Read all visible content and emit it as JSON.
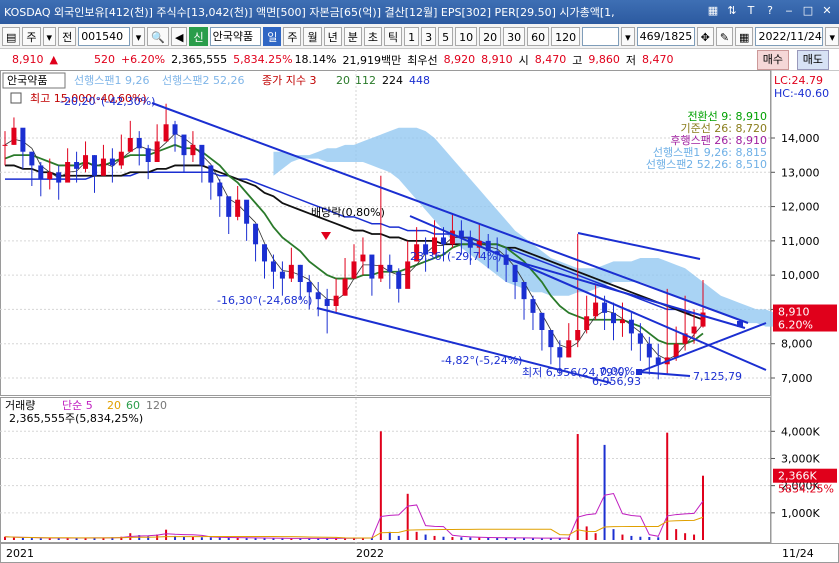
{
  "window": {
    "title": "KOSDAQ 외국인보유[412(천)] 주식수[13,042(천)] 액면[500] 자본금[65(억)] 결산[12월] EPS[302] PER[29.50] 시가총액[1,"
  },
  "toolbar": {
    "menu_label": "주",
    "prev_label": "전",
    "code": "001540",
    "new_badge": "신",
    "stock_name": "안국약품",
    "periods": [
      "일",
      "주",
      "월",
      "년",
      "분",
      "초",
      "틱"
    ],
    "selected_period": "일",
    "minutes": [
      "1",
      "3",
      "5",
      "10",
      "20",
      "30",
      "60",
      "120"
    ],
    "count": "469/1825",
    "date": "2022/11/24"
  },
  "price_bar": {
    "price": "8,910",
    "change": "520",
    "change_pct": "+6.20%",
    "volume": "2,365,555",
    "volume_pct": "5,834.25%",
    "turnover": "18.14%",
    "amount": "21,919백만",
    "best_ask_label": "최우선",
    "best_ask": "8,920",
    "best_bid": "8,910",
    "open_label": "시",
    "open": "8,470",
    "high_label": "고",
    "high": "9,860",
    "low_label": "저",
    "low": "8,470",
    "buy_label": "매수",
    "sell_label": "매도"
  },
  "chart_data": {
    "type": "line",
    "price_panel": {
      "legend": {
        "stock": "안국약품",
        "span1": "선행스팬1 9,26",
        "span2": "선행스팬2 52,26",
        "close_prefix": "종가 지수 3",
        "ma20": "20",
        "ma112": "112",
        "ma224": "224",
        "ma448": "448"
      },
      "right_info": {
        "lc": "LC:24.79",
        "hc": "HC:-40.60"
      },
      "ichimoku_legend": [
        {
          "text": "전환선 9: 8,910",
          "color": "#00a000"
        },
        {
          "text": "기준선 26: 8,720",
          "color": "#8a7d1c"
        },
        {
          "text": "후행스팬 26: 8,910",
          "color": "#a020a0"
        },
        {
          "text": "선행스팬1 9,26: 8,815",
          "color": "#6fb0e6"
        },
        {
          "text": "선행스팬2 52,26: 8,510",
          "color": "#6fb0e6"
        }
      ],
      "y_ticks": [
        7000,
        8000,
        9000,
        10000,
        11000,
        12000,
        13000,
        14000
      ],
      "y_tick_labels": [
        "7,000",
        "8,000",
        "9,000",
        "10,000",
        "11,000",
        "12,000",
        "13,000",
        "14,000"
      ],
      "ylim": [
        6650,
        15400
      ],
      "current_price": 8910,
      "current_price_label": "8,910",
      "current_pct_label": "6.20%",
      "annotations": {
        "high": "최고 15,000(-40,60%)",
        "high_trend": "-20,20°(-42,30%)",
        "dividend": "배당락(0.80%)",
        "trend1": "-16,30°(-24,68%)",
        "trend2": "23,36°(-29,74%)",
        "trend3": "-4,82°(-5,24%)",
        "low": "최저 6,956(24,79%)",
        "low_val": "6,956,93",
        "low_val2": "7,125,79",
        "mid_val": "0,00%"
      }
    },
    "volume_panel": {
      "legend": {
        "title": "거래량",
        "ma5": "단순 5",
        "ma20": "20",
        "ma60": "60",
        "ma120": "120"
      },
      "summary": "2,365,555주(5,834,25%)",
      "y_ticks": [
        1000000,
        2000000,
        3000000,
        4000000
      ],
      "y_tick_labels": [
        "1,000K",
        "2,000K",
        "3,000K",
        "4,000K"
      ],
      "ylim": [
        0,
        4600000
      ],
      "current_label": "2,366K",
      "current_pct_label": "5834.25%"
    },
    "x_labels": [
      "2021",
      "2022",
      "11/24"
    ],
    "close": [
      13800,
      14300,
      13600,
      13200,
      12800,
      13000,
      12700,
      13300,
      13100,
      13500,
      12900,
      13400,
      13200,
      13600,
      14000,
      13700,
      13300,
      13900,
      14400,
      14100,
      13500,
      13800,
      13200,
      12700,
      12300,
      11700,
      12200,
      11500,
      10900,
      10400,
      10100,
      9900,
      10300,
      9800,
      9500,
      9300,
      9100,
      9400,
      9900,
      10400,
      10600,
      9900,
      10300,
      10100,
      9600,
      10400,
      10900,
      10600,
      11100,
      10900,
      11300,
      11100,
      10800,
      11000,
      10700,
      10600,
      10300,
      9800,
      9300,
      8900,
      8400,
      7900,
      7600,
      8100,
      8400,
      8800,
      9200,
      8900,
      8600,
      8700,
      8300,
      8000,
      7600,
      7400,
      7600,
      8000,
      8300,
      8500,
      8910
    ],
    "high": [
      14200,
      14600,
      14100,
      13600,
      13300,
      13400,
      13200,
      13700,
      13600,
      13900,
      13500,
      13800,
      13700,
      14100,
      14500,
      14200,
      13800,
      14400,
      15000,
      14500,
      14000,
      14200,
      13700,
      13200,
      12800,
      12200,
      12600,
      12000,
      11400,
      10900,
      10600,
      10400,
      10800,
      10300,
      10000,
      9800,
      9600,
      9900,
      10500,
      10900,
      11100,
      10500,
      12900,
      10600,
      10200,
      11000,
      11400,
      11100,
      11600,
      11400,
      11800,
      11600,
      11300,
      11500,
      11200,
      11100,
      10800,
      10300,
      9800,
      9400,
      8900,
      8400,
      8100,
      8600,
      11200,
      9400,
      9700,
      9400,
      9200,
      9200,
      8900,
      8600,
      8200,
      8000,
      9600,
      8500,
      9400,
      9000,
      9860
    ],
    "low": [
      13200,
      13800,
      13100,
      12600,
      12300,
      12500,
      12200,
      12800,
      12700,
      13000,
      12400,
      12900,
      12700,
      13100,
      13600,
      13200,
      12800,
      13400,
      13900,
      13600,
      13000,
      13300,
      12700,
      12200,
      11700,
      11200,
      11600,
      11000,
      10400,
      9900,
      9600,
      9400,
      9800,
      9300,
      9000,
      8800,
      8300,
      8900,
      9400,
      9900,
      10000,
      9400,
      9800,
      9600,
      9200,
      9900,
      10400,
      10100,
      10600,
      10400,
      10800,
      10600,
      10300,
      10500,
      10200,
      10100,
      9800,
      9300,
      8700,
      8400,
      7800,
      7400,
      7100,
      7600,
      7900,
      8300,
      8700,
      8400,
      8100,
      8200,
      7800,
      7500,
      7100,
      6960,
      7100,
      7500,
      7800,
      8000,
      8470
    ],
    "ma20": [
      13400,
      13500,
      13500,
      13500,
      13400,
      13300,
      13200,
      13200,
      13200,
      13300,
      13200,
      13200,
      13300,
      13400,
      13500,
      13500,
      13500,
      13600,
      13700,
      13800,
      13700,
      13700,
      13600,
      13400,
      13200,
      12900,
      12700,
      12400,
      12100,
      11800,
      11400,
      11100,
      10900,
      10700,
      10400,
      10200,
      10000,
      9900,
      9900,
      9900,
      10000,
      10000,
      10100,
      10100,
      10100,
      10200,
      10300,
      10400,
      10500,
      10600,
      10800,
      10900,
      10900,
      10900,
      10900,
      10900,
      10800,
      10600,
      10400,
      10100,
      9800,
      9400,
      9100,
      8900,
      8800,
      8700,
      8700,
      8700,
      8700,
      8700,
      8600,
      8500,
      8300,
      8100,
      8000,
      8000,
      8000,
      8100,
      8300
    ],
    "ma112": [
      13200,
      13200,
      13100,
      13100,
      13000,
      13000,
      12900,
      12900,
      12900,
      12900,
      12900,
      12900,
      12900,
      12900,
      13000,
      13000,
      13000,
      13100,
      13100,
      13200,
      13200,
      13200,
      13200,
      13100,
      13000,
      12900,
      12800,
      12700,
      12600,
      12400,
      12300,
      12100,
      12000,
      11900,
      11800,
      11700,
      11600,
      11500,
      11400,
      11300,
      11300,
      11200,
      11200,
      11100,
      11100,
      11000,
      11000,
      11000,
      11000,
      10900,
      10900,
      10900,
      10900,
      10900,
      10900,
      10900,
      10800,
      10800,
      10700,
      10600,
      10500,
      10400,
      10300,
      10200,
      10100,
      10000,
      9900,
      9800,
      9700,
      9600,
      9500,
      9400,
      9300,
      9200,
      9100,
      9000,
      8900,
      8800,
      8700
    ],
    "ma224": [
      12800,
      12800,
      12800,
      12800,
      12800,
      12800,
      12800,
      12800,
      12800,
      12800,
      12900,
      12900,
      12900,
      12900,
      12900,
      13000,
      13000,
      13000,
      13000,
      13000,
      13000,
      13000,
      13000,
      13000,
      12900,
      12900,
      12800,
      12800,
      12700,
      12600,
      12500,
      12400,
      12300,
      12200,
      12100,
      12000,
      11900,
      11800,
      11700,
      11700,
      11600,
      11500,
      11500,
      11400,
      11400,
      11300,
      11300,
      11300,
      11200,
      11200,
      11200,
      11100,
      11100,
      11000,
      10900,
      10900,
      10800,
      10700,
      10600,
      10500,
      10400,
      10300,
      10200,
      10100,
      10000,
      9900,
      9800,
      9700,
      9600,
      9500,
      9400,
      9300,
      9200,
      9100,
      9000,
      9000,
      8900,
      8900,
      8800
    ],
    "volume": [
      120000,
      90000,
      80000,
      70000,
      60000,
      70000,
      80000,
      90000,
      60000,
      70000,
      80000,
      90000,
      100000,
      120000,
      250000,
      180000,
      140000,
      200000,
      380000,
      150000,
      120000,
      110000,
      100000,
      90000,
      90000,
      80000,
      80000,
      70000,
      70000,
      60000,
      60000,
      60000,
      60000,
      60000,
      60000,
      60000,
      70000,
      60000,
      70000,
      70000,
      80000,
      90000,
      4000000,
      300000,
      150000,
      1700000,
      300000,
      200000,
      150000,
      120000,
      110000,
      100000,
      90000,
      90000,
      80000,
      80000,
      80000,
      70000,
      70000,
      70000,
      60000,
      70000,
      80000,
      90000,
      3900000,
      500000,
      250000,
      3500000,
      400000,
      200000,
      150000,
      120000,
      110000,
      100000,
      3950000,
      400000,
      250000,
      200000,
      2366000
    ],
    "span_a": [
      12900,
      13100,
      13300,
      13400,
      13500,
      13600,
      13700,
      13700,
      13800,
      13800,
      13900,
      14000,
      14100,
      14200,
      14300,
      14300,
      14300,
      14200,
      14000,
      13700,
      13400,
      13100,
      12800,
      12500,
      12200,
      11900,
      11600,
      11300,
      11100,
      10900,
      10700,
      10500,
      10400,
      10300,
      10200,
      10200,
      10200,
      10300,
      10400,
      10400,
      10400,
      10500,
      10500,
      10500,
      10400,
      10300,
      10200,
      10000,
      9800,
      9600,
      9400,
      9300,
      9200,
      9100,
      9000,
      9000,
      8900,
      8900,
      8800,
      8800,
      8800,
      8800,
      8815
    ],
    "span_b": [
      13600,
      13600,
      13500,
      13500,
      13400,
      13400,
      13300,
      13300,
      13300,
      13300,
      13300,
      13200,
      13100,
      13000,
      12800,
      12500,
      12200,
      11900,
      11600,
      11300,
      11000,
      10800,
      10600,
      10400,
      10200,
      10000,
      9800,
      9700,
      9600,
      9500,
      9500,
      9400,
      9400,
      9400,
      9500,
      9500,
      9600,
      9700,
      9800,
      9800,
      9800,
      9800,
      9700,
      9600,
      9500,
      9400,
      9300,
      9200,
      9100,
      9000,
      8900,
      8800,
      8700,
      8600,
      8600,
      8500,
      8500,
      8500,
      8500,
      8500,
      8510,
      8510,
      8510
    ]
  }
}
